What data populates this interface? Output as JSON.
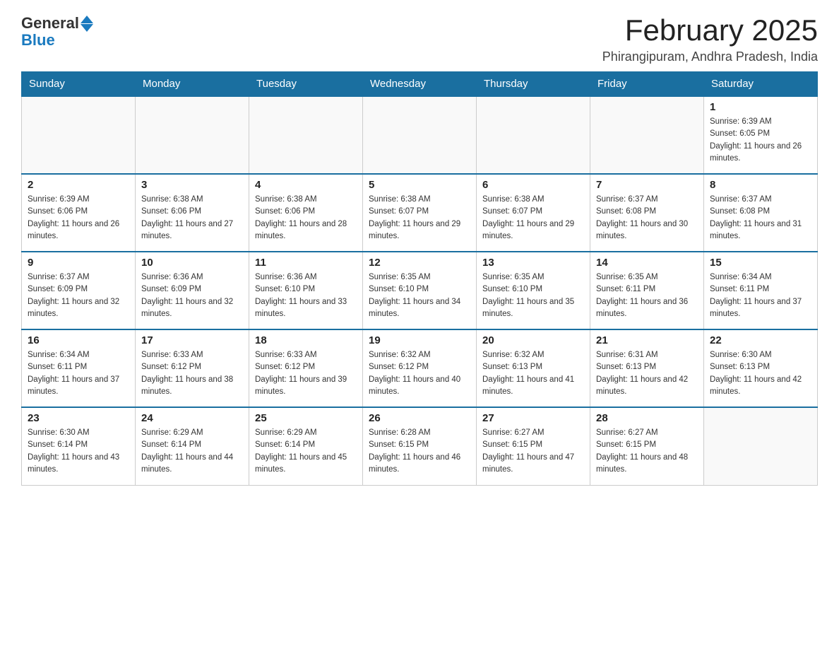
{
  "header": {
    "logo_general": "General",
    "logo_blue": "Blue",
    "title": "February 2025",
    "subtitle": "Phirangipuram, Andhra Pradesh, India"
  },
  "weekdays": [
    "Sunday",
    "Monday",
    "Tuesday",
    "Wednesday",
    "Thursday",
    "Friday",
    "Saturday"
  ],
  "weeks": [
    [
      {
        "day": "",
        "sunrise": "",
        "sunset": "",
        "daylight": ""
      },
      {
        "day": "",
        "sunrise": "",
        "sunset": "",
        "daylight": ""
      },
      {
        "day": "",
        "sunrise": "",
        "sunset": "",
        "daylight": ""
      },
      {
        "day": "",
        "sunrise": "",
        "sunset": "",
        "daylight": ""
      },
      {
        "day": "",
        "sunrise": "",
        "sunset": "",
        "daylight": ""
      },
      {
        "day": "",
        "sunrise": "",
        "sunset": "",
        "daylight": ""
      },
      {
        "day": "1",
        "sunrise": "Sunrise: 6:39 AM",
        "sunset": "Sunset: 6:05 PM",
        "daylight": "Daylight: 11 hours and 26 minutes."
      }
    ],
    [
      {
        "day": "2",
        "sunrise": "Sunrise: 6:39 AM",
        "sunset": "Sunset: 6:06 PM",
        "daylight": "Daylight: 11 hours and 26 minutes."
      },
      {
        "day": "3",
        "sunrise": "Sunrise: 6:38 AM",
        "sunset": "Sunset: 6:06 PM",
        "daylight": "Daylight: 11 hours and 27 minutes."
      },
      {
        "day": "4",
        "sunrise": "Sunrise: 6:38 AM",
        "sunset": "Sunset: 6:06 PM",
        "daylight": "Daylight: 11 hours and 28 minutes."
      },
      {
        "day": "5",
        "sunrise": "Sunrise: 6:38 AM",
        "sunset": "Sunset: 6:07 PM",
        "daylight": "Daylight: 11 hours and 29 minutes."
      },
      {
        "day": "6",
        "sunrise": "Sunrise: 6:38 AM",
        "sunset": "Sunset: 6:07 PM",
        "daylight": "Daylight: 11 hours and 29 minutes."
      },
      {
        "day": "7",
        "sunrise": "Sunrise: 6:37 AM",
        "sunset": "Sunset: 6:08 PM",
        "daylight": "Daylight: 11 hours and 30 minutes."
      },
      {
        "day": "8",
        "sunrise": "Sunrise: 6:37 AM",
        "sunset": "Sunset: 6:08 PM",
        "daylight": "Daylight: 11 hours and 31 minutes."
      }
    ],
    [
      {
        "day": "9",
        "sunrise": "Sunrise: 6:37 AM",
        "sunset": "Sunset: 6:09 PM",
        "daylight": "Daylight: 11 hours and 32 minutes."
      },
      {
        "day": "10",
        "sunrise": "Sunrise: 6:36 AM",
        "sunset": "Sunset: 6:09 PM",
        "daylight": "Daylight: 11 hours and 32 minutes."
      },
      {
        "day": "11",
        "sunrise": "Sunrise: 6:36 AM",
        "sunset": "Sunset: 6:10 PM",
        "daylight": "Daylight: 11 hours and 33 minutes."
      },
      {
        "day": "12",
        "sunrise": "Sunrise: 6:35 AM",
        "sunset": "Sunset: 6:10 PM",
        "daylight": "Daylight: 11 hours and 34 minutes."
      },
      {
        "day": "13",
        "sunrise": "Sunrise: 6:35 AM",
        "sunset": "Sunset: 6:10 PM",
        "daylight": "Daylight: 11 hours and 35 minutes."
      },
      {
        "day": "14",
        "sunrise": "Sunrise: 6:35 AM",
        "sunset": "Sunset: 6:11 PM",
        "daylight": "Daylight: 11 hours and 36 minutes."
      },
      {
        "day": "15",
        "sunrise": "Sunrise: 6:34 AM",
        "sunset": "Sunset: 6:11 PM",
        "daylight": "Daylight: 11 hours and 37 minutes."
      }
    ],
    [
      {
        "day": "16",
        "sunrise": "Sunrise: 6:34 AM",
        "sunset": "Sunset: 6:11 PM",
        "daylight": "Daylight: 11 hours and 37 minutes."
      },
      {
        "day": "17",
        "sunrise": "Sunrise: 6:33 AM",
        "sunset": "Sunset: 6:12 PM",
        "daylight": "Daylight: 11 hours and 38 minutes."
      },
      {
        "day": "18",
        "sunrise": "Sunrise: 6:33 AM",
        "sunset": "Sunset: 6:12 PM",
        "daylight": "Daylight: 11 hours and 39 minutes."
      },
      {
        "day": "19",
        "sunrise": "Sunrise: 6:32 AM",
        "sunset": "Sunset: 6:12 PM",
        "daylight": "Daylight: 11 hours and 40 minutes."
      },
      {
        "day": "20",
        "sunrise": "Sunrise: 6:32 AM",
        "sunset": "Sunset: 6:13 PM",
        "daylight": "Daylight: 11 hours and 41 minutes."
      },
      {
        "day": "21",
        "sunrise": "Sunrise: 6:31 AM",
        "sunset": "Sunset: 6:13 PM",
        "daylight": "Daylight: 11 hours and 42 minutes."
      },
      {
        "day": "22",
        "sunrise": "Sunrise: 6:30 AM",
        "sunset": "Sunset: 6:13 PM",
        "daylight": "Daylight: 11 hours and 42 minutes."
      }
    ],
    [
      {
        "day": "23",
        "sunrise": "Sunrise: 6:30 AM",
        "sunset": "Sunset: 6:14 PM",
        "daylight": "Daylight: 11 hours and 43 minutes."
      },
      {
        "day": "24",
        "sunrise": "Sunrise: 6:29 AM",
        "sunset": "Sunset: 6:14 PM",
        "daylight": "Daylight: 11 hours and 44 minutes."
      },
      {
        "day": "25",
        "sunrise": "Sunrise: 6:29 AM",
        "sunset": "Sunset: 6:14 PM",
        "daylight": "Daylight: 11 hours and 45 minutes."
      },
      {
        "day": "26",
        "sunrise": "Sunrise: 6:28 AM",
        "sunset": "Sunset: 6:15 PM",
        "daylight": "Daylight: 11 hours and 46 minutes."
      },
      {
        "day": "27",
        "sunrise": "Sunrise: 6:27 AM",
        "sunset": "Sunset: 6:15 PM",
        "daylight": "Daylight: 11 hours and 47 minutes."
      },
      {
        "day": "28",
        "sunrise": "Sunrise: 6:27 AM",
        "sunset": "Sunset: 6:15 PM",
        "daylight": "Daylight: 11 hours and 48 minutes."
      },
      {
        "day": "",
        "sunrise": "",
        "sunset": "",
        "daylight": ""
      }
    ]
  ]
}
